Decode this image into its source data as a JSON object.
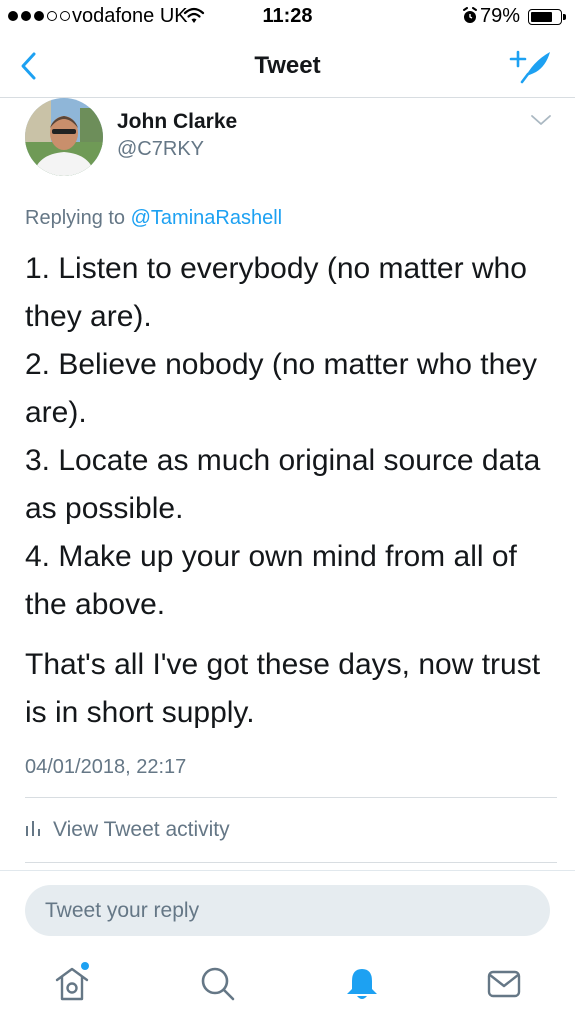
{
  "status_bar": {
    "carrier": "vodafone UK",
    "time": "11:28",
    "battery_percent": "79%",
    "battery_level": 0.79,
    "signal_bars_filled": 3,
    "signal_bars_total": 5
  },
  "nav": {
    "title": "Tweet",
    "back_icon": "chevron-left-icon",
    "compose_icon": "compose-tweet-icon"
  },
  "tweet": {
    "author_name": "John Clarke",
    "author_handle": "@C7RKY",
    "replying_prefix": "Replying to",
    "replying_to": "@TaminaRashell",
    "paragraph1": "1. Listen to everybody (no matter who they are).\n2. Believe nobody (no matter who they are).\n3. Locate as much original source data as possible.\n4. Make up your own mind from all of the above.",
    "paragraph2": "That's all I've got these days, now trust is in short supply.",
    "timestamp": "04/01/2018, 22:17"
  },
  "activity": {
    "label": "View Tweet activity",
    "icon": "bar-chart-icon"
  },
  "reply": {
    "placeholder": "Tweet your reply"
  },
  "tab_bar": [
    {
      "name": "home",
      "icon": "home-icon",
      "has_notification_dot": true
    },
    {
      "name": "search",
      "icon": "search-icon"
    },
    {
      "name": "notifications",
      "icon": "bell-icon",
      "active": true
    },
    {
      "name": "messages",
      "icon": "envelope-icon"
    }
  ],
  "colors": {
    "accent": "#1da1f2",
    "text_primary": "#14171a",
    "text_secondary": "#657786",
    "reply_box_bg": "#e6ecf0"
  }
}
